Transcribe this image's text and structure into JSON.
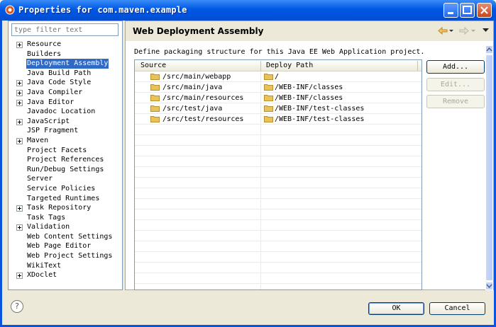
{
  "window": {
    "title": "Properties for com.maven.example"
  },
  "filter": {
    "placeholder": "type filter text"
  },
  "tree": [
    {
      "label": "Resource",
      "expandable": true
    },
    {
      "label": "Builders",
      "expandable": false
    },
    {
      "label": "Deployment Assembly",
      "expandable": false,
      "selected": true
    },
    {
      "label": "Java Build Path",
      "expandable": false
    },
    {
      "label": "Java Code Style",
      "expandable": true
    },
    {
      "label": "Java Compiler",
      "expandable": true
    },
    {
      "label": "Java Editor",
      "expandable": true
    },
    {
      "label": "Javadoc Location",
      "expandable": false
    },
    {
      "label": "JavaScript",
      "expandable": true
    },
    {
      "label": "JSP Fragment",
      "expandable": false
    },
    {
      "label": "Maven",
      "expandable": true
    },
    {
      "label": "Project Facets",
      "expandable": false
    },
    {
      "label": "Project References",
      "expandable": false
    },
    {
      "label": "Run/Debug Settings",
      "expandable": false
    },
    {
      "label": "Server",
      "expandable": false
    },
    {
      "label": "Service Policies",
      "expandable": false
    },
    {
      "label": "Targeted Runtimes",
      "expandable": false
    },
    {
      "label": "Task Repository",
      "expandable": true
    },
    {
      "label": "Task Tags",
      "expandable": false
    },
    {
      "label": "Validation",
      "expandable": true
    },
    {
      "label": "Web Content Settings",
      "expandable": false
    },
    {
      "label": "Web Page Editor",
      "expandable": false
    },
    {
      "label": "Web Project Settings",
      "expandable": false
    },
    {
      "label": "WikiText",
      "expandable": false
    },
    {
      "label": "XDoclet",
      "expandable": true
    }
  ],
  "page": {
    "title": "Web Deployment Assembly",
    "description": "Define packaging structure for this Java EE Web Application project."
  },
  "table": {
    "columns": [
      "Source",
      "Deploy Path"
    ],
    "rows": [
      {
        "source": "/src/main/webapp",
        "deploy": "/"
      },
      {
        "source": "/src/main/java",
        "deploy": "/WEB-INF/classes"
      },
      {
        "source": "/src/main/resources",
        "deploy": "/WEB-INF/classes"
      },
      {
        "source": "/src/test/java",
        "deploy": "/WEB-INF/test-classes"
      },
      {
        "source": "/src/test/resources",
        "deploy": "/WEB-INF/test-classes"
      }
    ]
  },
  "buttons": {
    "add": "Add...",
    "edit": "Edit...",
    "remove": "Remove",
    "ok": "OK",
    "cancel": "Cancel"
  },
  "help": {
    "glyph": "?"
  },
  "colors": {
    "selection": "#316ac5",
    "titlebar": "#0058e6",
    "folder": "#e8c25a"
  }
}
